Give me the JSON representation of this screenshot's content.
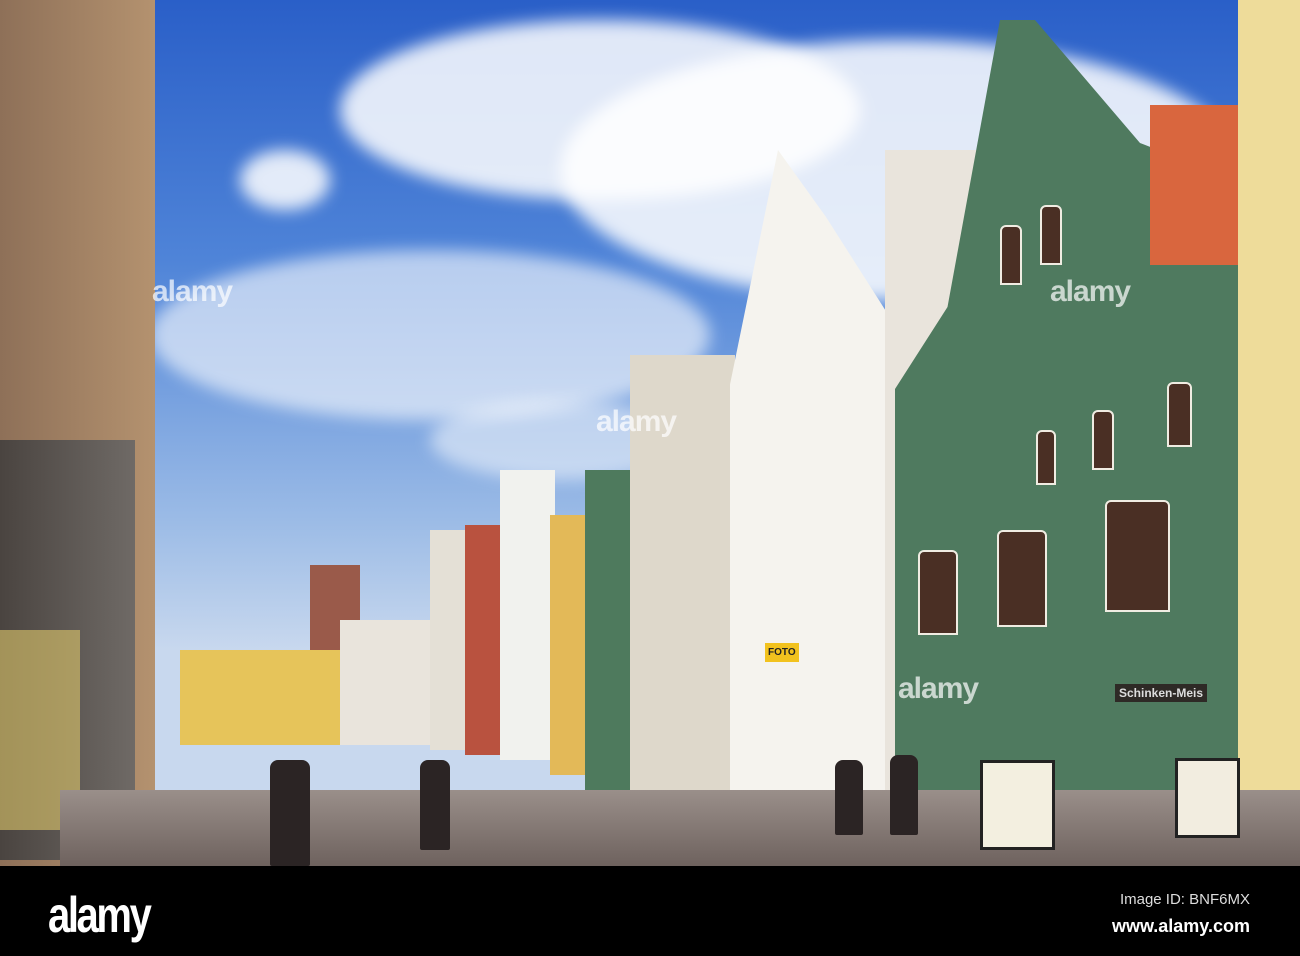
{
  "watermark": {
    "logo": "alamy",
    "image_id": "Image ID: BNF6MX",
    "url": "www.alamy.com",
    "overlay": "alamy"
  },
  "signs": {
    "foto": "FOTO",
    "shop": "Schinken-Meis"
  }
}
